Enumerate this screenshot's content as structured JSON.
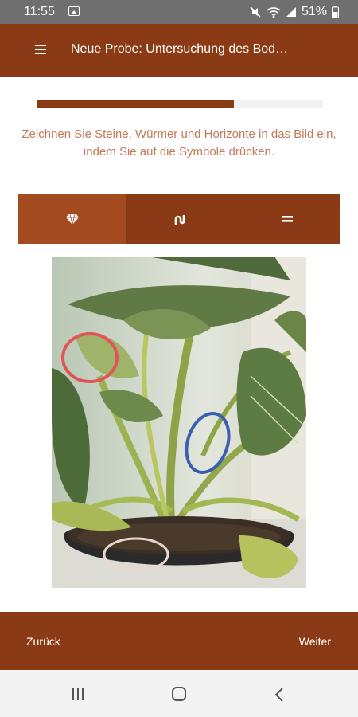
{
  "status_bar": {
    "time": "11:55",
    "battery": "51%",
    "icons": [
      "image-icon",
      "mute-icon",
      "wifi-icon",
      "signal-icon",
      "battery-icon"
    ]
  },
  "app_bar": {
    "title": "Neue Probe: Untersuchung des Bod…",
    "menu_icon": "hamburger-menu-icon"
  },
  "progress": {
    "value_percent": 69
  },
  "instruction": "Zeichnen Sie Steine, Würmer und Horizonte in das Bild ein, indem Sie auf die Symbole drücken.",
  "toolbar": {
    "tools": [
      {
        "icon": "gem-icon",
        "meaning": "stones",
        "active": true
      },
      {
        "icon": "worm-icon",
        "meaning": "worms",
        "active": false
      },
      {
        "icon": "horizon-lines-icon",
        "meaning": "horizons",
        "active": false
      }
    ]
  },
  "annotations": [
    {
      "type": "stone",
      "color": "#e05656"
    },
    {
      "type": "worm",
      "color": "#3b5fb0"
    },
    {
      "type": "horizon",
      "color": "#e8d6d0"
    }
  ],
  "footer": {
    "back_label": "Zurück",
    "next_label": "Weiter"
  },
  "colors": {
    "primary": "#8a3a14",
    "primary_active": "#a44a20",
    "instruction_text": "#c27a5a"
  }
}
